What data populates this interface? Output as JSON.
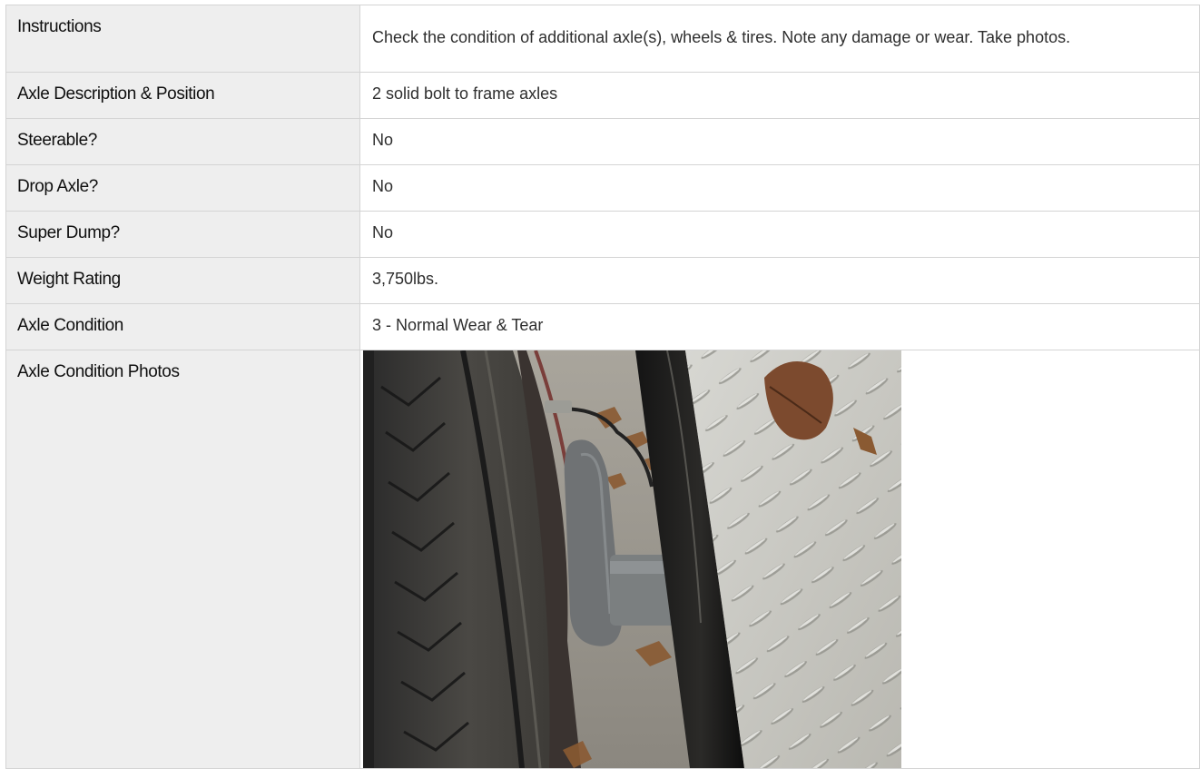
{
  "rows": [
    {
      "label": "Instructions",
      "value": "Check the condition of additional axle(s), wheels & tires. Note any damage or wear. Take photos."
    },
    {
      "label": "Axle Description & Position",
      "value": "2 solid bolt to frame axles"
    },
    {
      "label": "Steerable?",
      "value": "No"
    },
    {
      "label": "Drop Axle?",
      "value": "No"
    },
    {
      "label": "Super Dump?",
      "value": "No"
    },
    {
      "label": "Weight Rating",
      "value": "3,750lbs."
    },
    {
      "label": "Axle Condition",
      "value": "3 - Normal Wear & Tear"
    },
    {
      "label": "Axle Condition Photos",
      "value": ""
    }
  ]
}
